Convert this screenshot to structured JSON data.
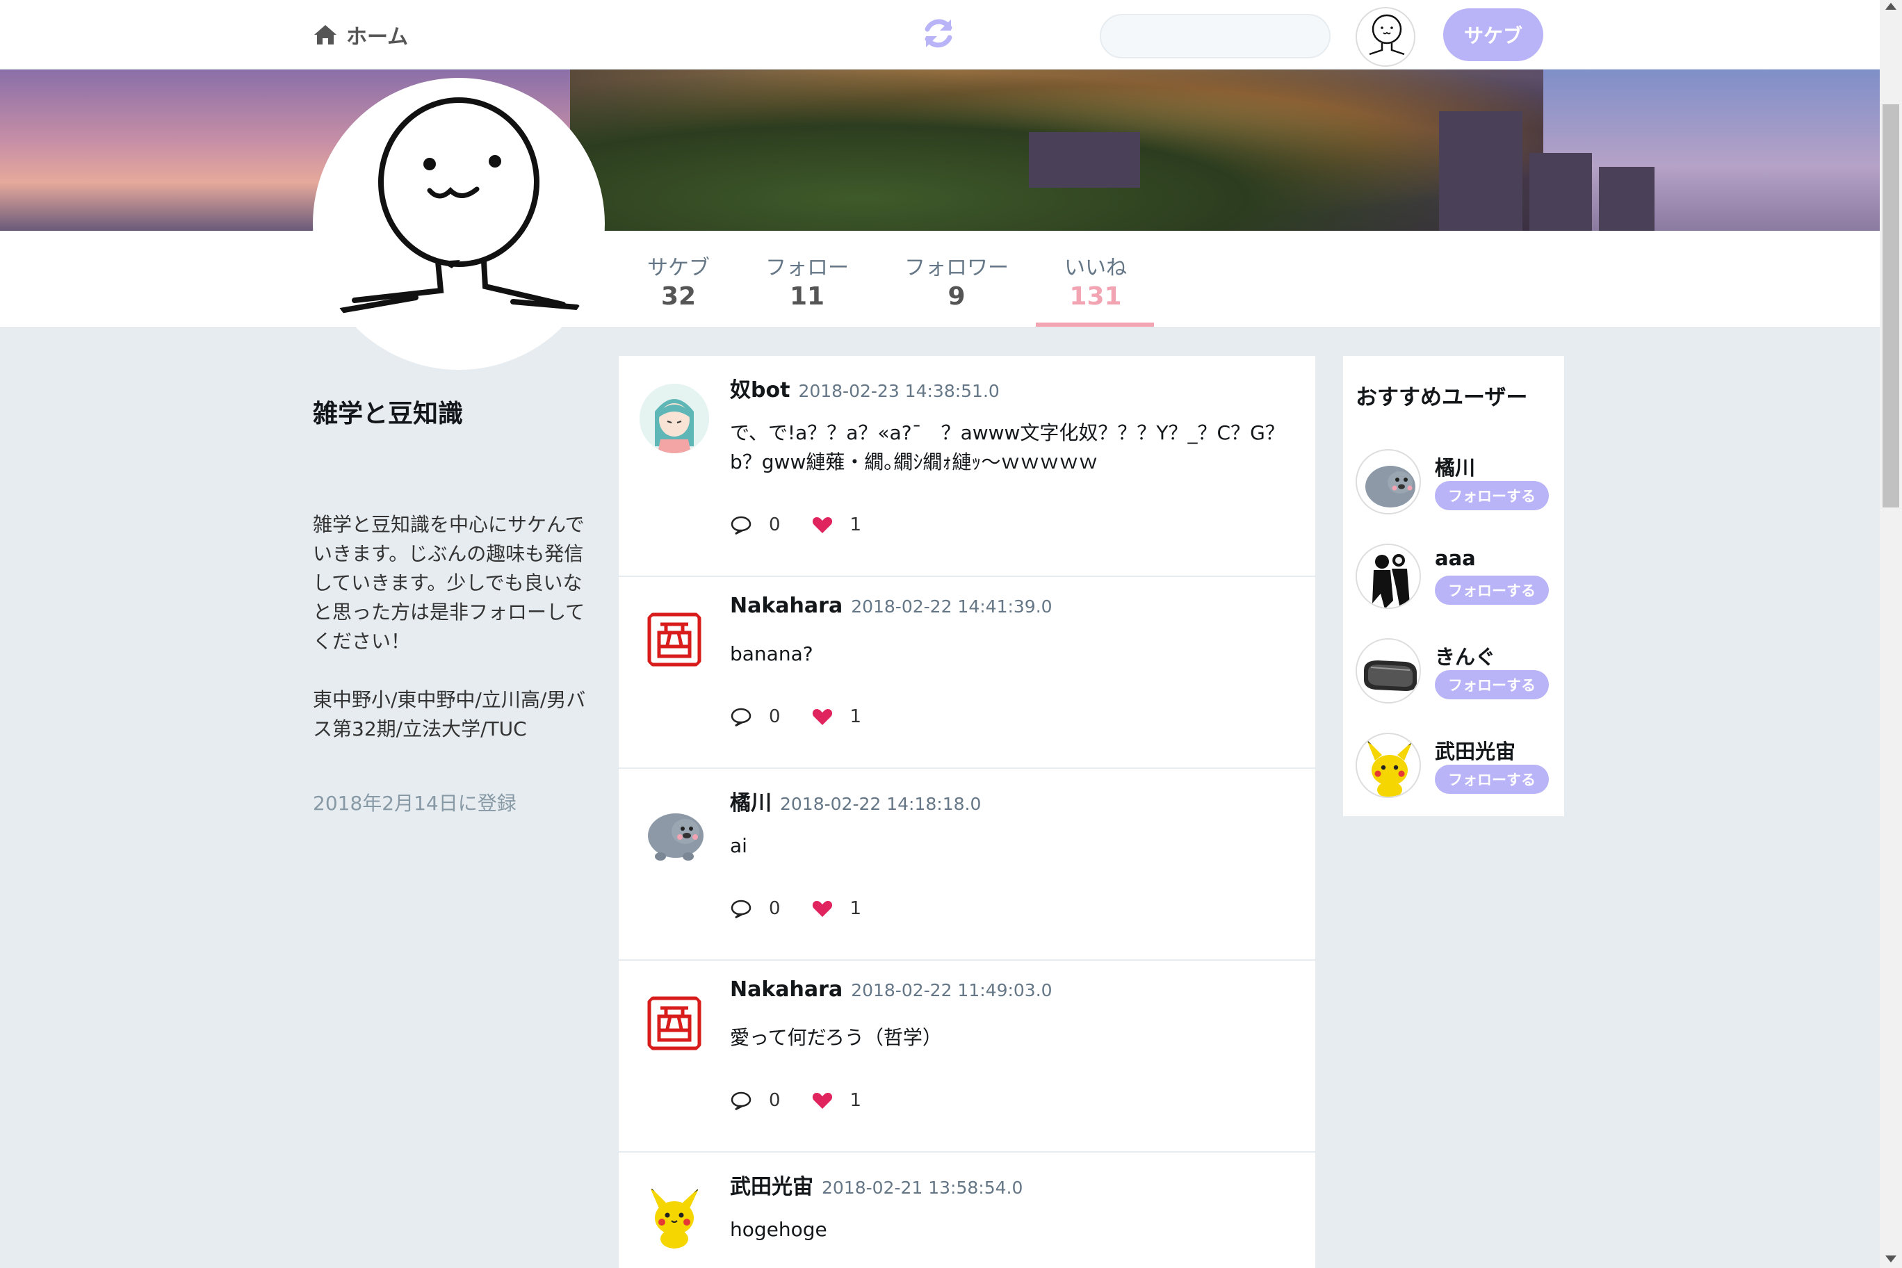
{
  "nav": {
    "home_label": "ホーム",
    "search_value": "",
    "post_button_label": "サケブ",
    "accent_color": "#b9b3f7"
  },
  "profile": {
    "stats": [
      {
        "label": "サケブ",
        "value": "32"
      },
      {
        "label": "フォロー",
        "value": "11"
      },
      {
        "label": "フォロワー",
        "value": "9"
      },
      {
        "label": "いいね",
        "value": "131",
        "active": true
      }
    ],
    "name": "雑学と豆知識",
    "bio": "雑学と豆知識を中心にサケんでいきます。じぶんの趣味も発信していきます。少しでも良いなと思った方は是非フォローしてください！\n\n東中野小/東中野中/立川高/男バス第32期/立法大学/TUC",
    "joined": "2018年2月14日に登録"
  },
  "feed": {
    "posts": [
      {
        "user": "奴bot",
        "time": "2018-02-23 14:38:51.0",
        "text": "で、で!a？？a？«a?¯　？awww文字化奴？？？Y？_？C？G？b？gww縺薙・繝｡繝ｼ繝ｫ縺ｯ～ｗｗｗｗｗ",
        "replies": "0",
        "likes": "1",
        "avatar": "anime-girl"
      },
      {
        "user": "Nakahara",
        "time": "2018-02-22 14:41:39.0",
        "text": "banana?",
        "replies": "0",
        "likes": "1",
        "avatar": "hanko-stamp"
      },
      {
        "user": "橘川",
        "time": "2018-02-22 14:18:18.0",
        "text": "ai",
        "replies": "0",
        "likes": "1",
        "avatar": "wombat"
      },
      {
        "user": "Nakahara",
        "time": "2018-02-22 11:49:03.0",
        "text": "愛って何だろう（哲学）",
        "replies": "0",
        "likes": "1",
        "avatar": "hanko-stamp"
      },
      {
        "user": "武田光宙",
        "time": "2018-02-21 13:58:54.0",
        "text": "hogehoge",
        "replies": "0",
        "likes": "1",
        "avatar": "pikachu"
      }
    ]
  },
  "recommend": {
    "title": "おすすめユーザー",
    "follow_label": "フォローする",
    "users": [
      {
        "name": "橘川",
        "avatar": "wombat"
      },
      {
        "name": "aaa",
        "avatar": "silhouette-couple"
      },
      {
        "name": "きんぐ",
        "avatar": "vr-headset"
      },
      {
        "name": "武田光宙",
        "avatar": "pikachu"
      }
    ]
  },
  "colors": {
    "like_active": "#f2a4b3",
    "heart": "#e0245e",
    "background": "#e6ecf0"
  }
}
